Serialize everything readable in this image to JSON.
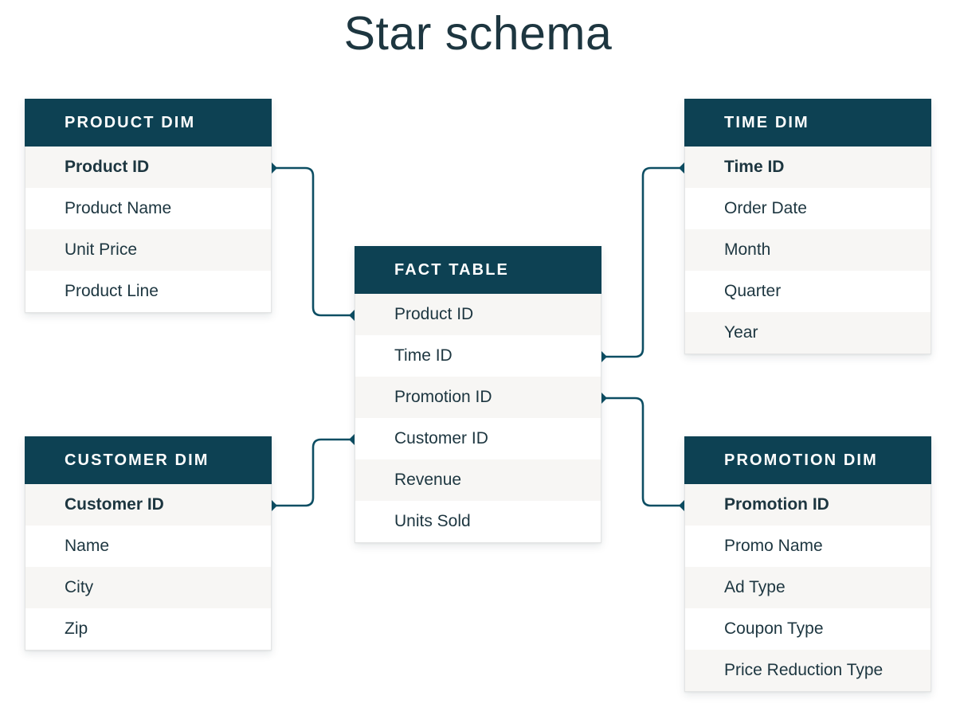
{
  "title": "Star schema",
  "colors": {
    "header_bg": "#0d4153",
    "text": "#1d3640",
    "row_alt_bg": "#f7f6f4",
    "row_bg": "#ffffff",
    "connector": "#0d4e63",
    "page_bg": "#ffffff"
  },
  "tables": {
    "product": {
      "header": "PRODUCT DIM",
      "rows": [
        {
          "label": "Product ID",
          "key": true
        },
        {
          "label": "Product Name",
          "key": false
        },
        {
          "label": "Unit Price",
          "key": false
        },
        {
          "label": "Product Line",
          "key": false
        }
      ]
    },
    "fact": {
      "header": "FACT TABLE",
      "rows": [
        {
          "label": "Product ID",
          "key": false
        },
        {
          "label": "Time ID",
          "key": false
        },
        {
          "label": "Promotion ID",
          "key": false
        },
        {
          "label": "Customer ID",
          "key": false
        },
        {
          "label": "Revenue",
          "key": false
        },
        {
          "label": "Units Sold",
          "key": false
        }
      ]
    },
    "time": {
      "header": "TIME DIM",
      "rows": [
        {
          "label": "Time ID",
          "key": true
        },
        {
          "label": "Order Date",
          "key": false
        },
        {
          "label": "Month",
          "key": false
        },
        {
          "label": "Quarter",
          "key": false
        },
        {
          "label": "Year",
          "key": false
        }
      ]
    },
    "customer": {
      "header": "CUSTOMER DIM",
      "rows": [
        {
          "label": "Customer ID",
          "key": true
        },
        {
          "label": "Name",
          "key": false
        },
        {
          "label": "City",
          "key": false
        },
        {
          "label": "Zip",
          "key": false
        }
      ]
    },
    "promotion": {
      "header": "PROMOTION DIM",
      "rows": [
        {
          "label": "Promotion ID",
          "key": true
        },
        {
          "label": "Promo Name",
          "key": false
        },
        {
          "label": "Ad Type",
          "key": false
        },
        {
          "label": "Coupon Type",
          "key": false
        },
        {
          "label": "Price Reduction Type",
          "key": false
        }
      ]
    }
  },
  "relationships": [
    {
      "name": "product-to-fact",
      "from": "PRODUCT DIM.Product ID",
      "to": "FACT TABLE.Product ID"
    },
    {
      "name": "fact-to-time",
      "from": "FACT TABLE.Time ID",
      "to": "TIME DIM.Time ID"
    },
    {
      "name": "fact-to-promotion",
      "from": "FACT TABLE.Promotion ID",
      "to": "PROMOTION DIM.Promotion ID"
    },
    {
      "name": "customer-to-fact",
      "from": "CUSTOMER DIM.Customer ID",
      "to": "FACT TABLE.Customer ID"
    }
  ]
}
